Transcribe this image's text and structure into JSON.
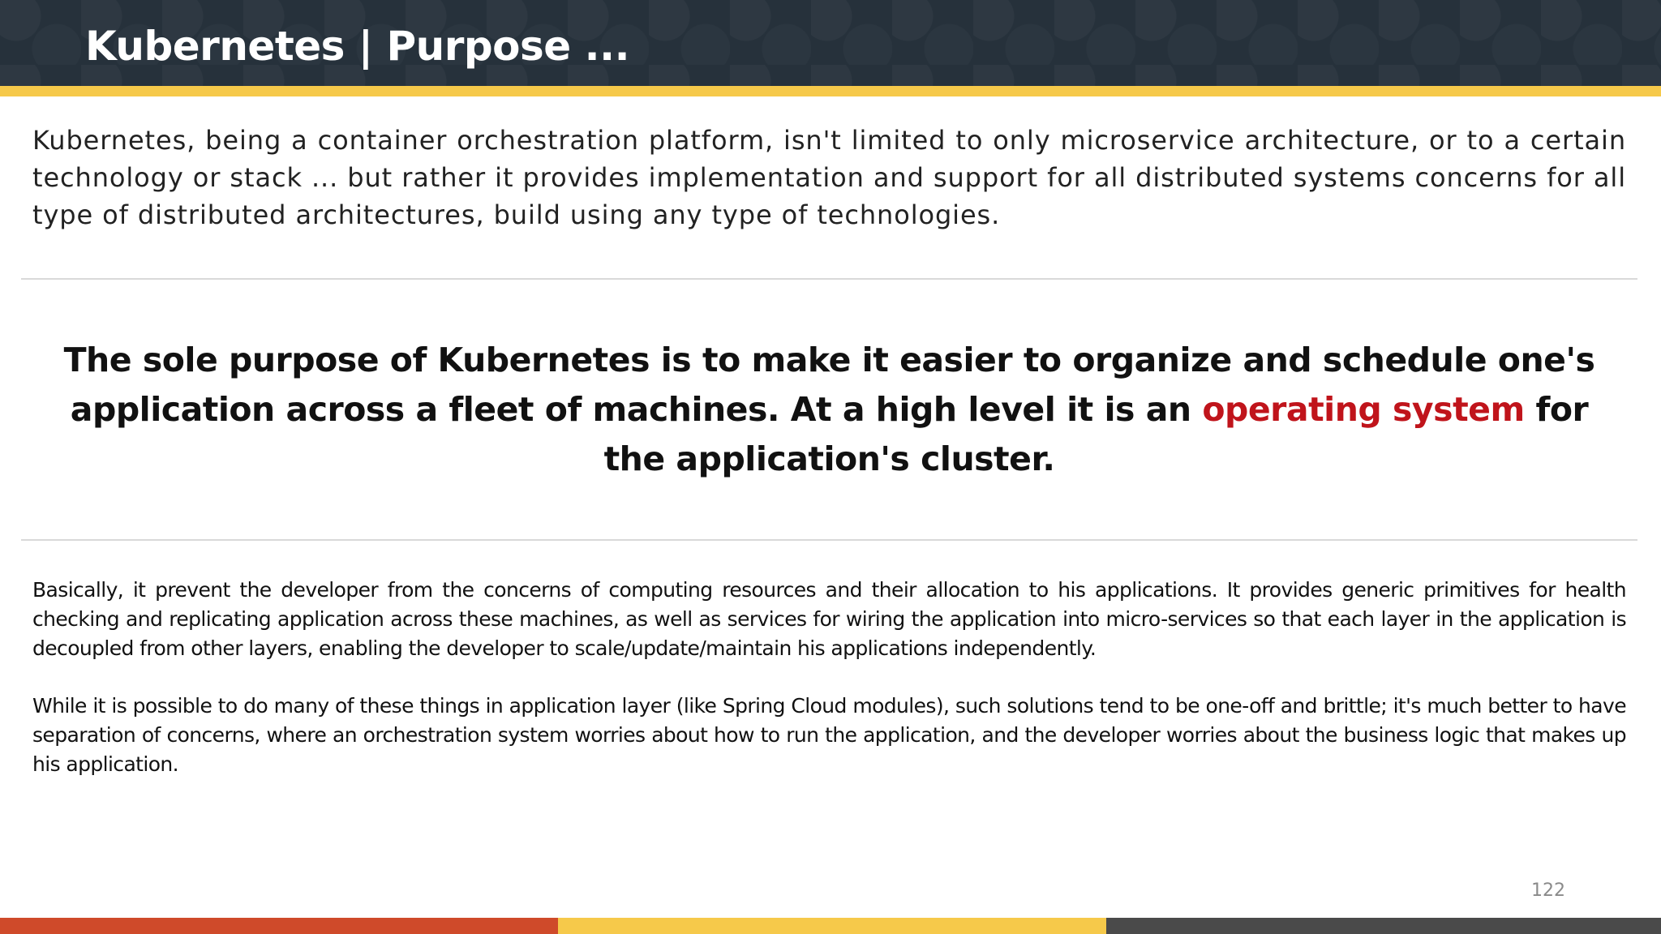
{
  "slide": {
    "title": "Kubernetes | Purpose ...",
    "intro": "Kubernetes, being a container orchestration platform, isn't limited to only microservice architecture, or to a certain technology or stack ... but rather it provides implementation and support for all distributed systems concerns for all type of distributed architectures, build using any type of technologies.",
    "quote": {
      "before": "The sole purpose of Kubernetes is to make it easier to organize and schedule one's application across a fleet of machines. At a high level it is an ",
      "highlight": "operating system",
      "after": " for the application's cluster."
    },
    "paragraph_1": "Basically, it prevent the developer from the concerns of computing resources and their allocation to his applications. It provides generic primitives for health checking and replicating application across these machines, as well as services for wiring the application into micro-services so that each layer in the application is decoupled from other layers, enabling the developer to scale/update/maintain his applications independently.",
    "paragraph_2": "While it is possible to do many of these things in application layer (like Spring Cloud modules), such solutions tend to be one-off and brittle; it's much better to have separation of concerns, where an orchestration system worries about how to run the application, and the developer worries about the business logic that makes up his application.",
    "page_number": "122"
  },
  "colors": {
    "header_background": "#26313b",
    "accent_yellow": "#f6c94a",
    "highlight_red": "#c0141b",
    "footer_red": "#cf4a2a",
    "footer_yellow": "#f6c94a",
    "footer_gray": "#4a4a4a"
  }
}
